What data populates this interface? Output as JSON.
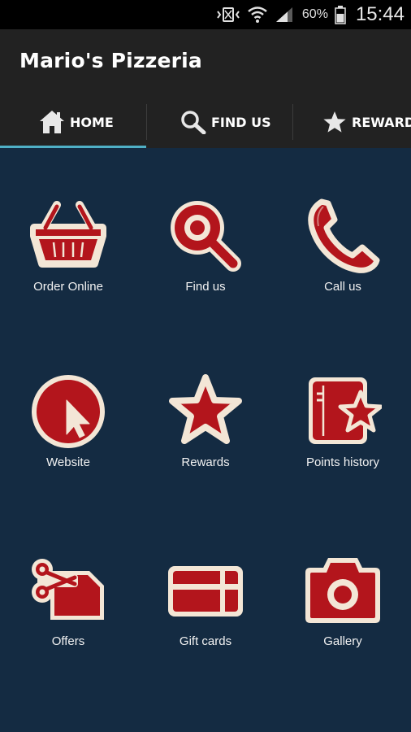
{
  "status_bar": {
    "battery_percent": "60%",
    "time": "15:44",
    "icons": [
      "vibrate-icon",
      "wifi-icon",
      "signal-icon",
      "battery-icon"
    ]
  },
  "app": {
    "title": "Mario's Pizzeria"
  },
  "tabs": [
    {
      "label": "HOME",
      "icon": "home-icon",
      "selected": true
    },
    {
      "label": "FIND US",
      "icon": "search-icon",
      "selected": false
    },
    {
      "label": "REWARDS",
      "icon": "star-icon",
      "selected": false
    }
  ],
  "tiles": [
    {
      "label": "Order Online",
      "icon": "basket-icon"
    },
    {
      "label": "Find us",
      "icon": "magnifier-icon"
    },
    {
      "label": "Call us",
      "icon": "phone-icon"
    },
    {
      "label": "Website",
      "icon": "cursor-icon"
    },
    {
      "label": "Rewards",
      "icon": "star-icon"
    },
    {
      "label": "Points history",
      "icon": "points-book-icon"
    },
    {
      "label": "Offers",
      "icon": "scissors-coupon-icon"
    },
    {
      "label": "Gift cards",
      "icon": "gift-card-icon"
    },
    {
      "label": "Gallery",
      "icon": "camera-icon"
    }
  ],
  "colors": {
    "background": "#142b42",
    "app_bar": "#222222",
    "tab_indicator": "#4fb0c6",
    "icon_red": "#b3151c",
    "icon_border": "#f3e6d6"
  }
}
